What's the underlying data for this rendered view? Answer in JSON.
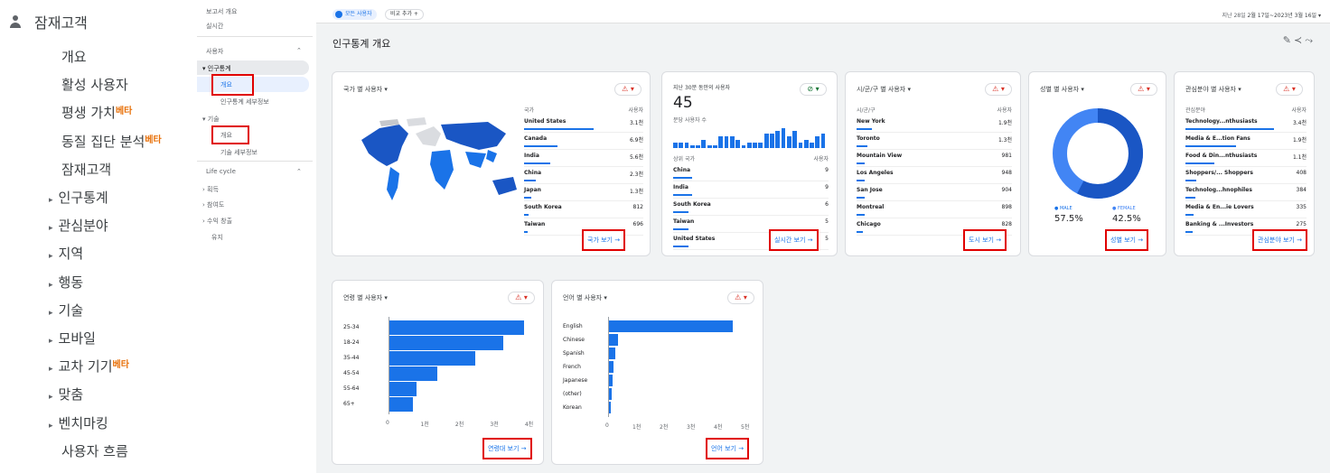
{
  "left_menu": {
    "header": "잠재고객",
    "items": [
      {
        "label": "개요",
        "caret": false,
        "beta": ""
      },
      {
        "label": "활성 사용자",
        "caret": false,
        "beta": ""
      },
      {
        "label": "평생 가치",
        "caret": false,
        "beta": "베타"
      },
      {
        "label": "동질 집단 분석",
        "caret": false,
        "beta": "베타"
      },
      {
        "label": "잠재고객",
        "caret": false,
        "beta": ""
      },
      {
        "label": "인구통계",
        "caret": true,
        "beta": ""
      },
      {
        "label": "관심분야",
        "caret": true,
        "beta": ""
      },
      {
        "label": "지역",
        "caret": true,
        "beta": ""
      },
      {
        "label": "행동",
        "caret": true,
        "beta": ""
      },
      {
        "label": "기술",
        "caret": true,
        "beta": ""
      },
      {
        "label": "모바일",
        "caret": true,
        "beta": ""
      },
      {
        "label": "교차 기기",
        "caret": true,
        "beta": "베타"
      },
      {
        "label": "맞춤",
        "caret": true,
        "beta": ""
      },
      {
        "label": "벤치마킹",
        "caret": true,
        "beta": ""
      },
      {
        "label": "사용자 흐름",
        "caret": false,
        "beta": ""
      }
    ]
  },
  "nav": {
    "report_overview": "보고서 개요",
    "realtime": "실시간",
    "user_section": "사용자",
    "demographics": "인구통계",
    "demo_overview": "개요",
    "demo_detail": "인구통계 세부정보",
    "tech": "기술",
    "tech_overview": "개요",
    "tech_detail": "기술 세부정보",
    "lifecycle": "Life cycle",
    "acquisition": "획득",
    "engagement": "참여도",
    "monetization": "수익 창출",
    "retention": "유지"
  },
  "top": {
    "all_users": "모든 사용자",
    "compare": "비교 추가 +",
    "date_prefix": "지난 28일",
    "date_range": "2월 17일~2023년 3월 16일",
    "page_title": "인구통계 개요"
  },
  "country": {
    "title": "국가 별 사용자 ▾",
    "col_k": "국가",
    "col_v": "사용자",
    "link": "국가 보기 →",
    "rows": [
      [
        "United States",
        "3.1천"
      ],
      [
        "Canada",
        "6.9천"
      ],
      [
        "India",
        "5.6천"
      ],
      [
        "China",
        "2.3천"
      ],
      [
        "Japan",
        "1.3천"
      ],
      [
        "South Korea",
        "812"
      ],
      [
        "Taiwan",
        "696"
      ]
    ]
  },
  "realtime": {
    "title": "지난 30분 동안의 사용자",
    "value": "45",
    "per_min": "분당 사용자 수",
    "col_k": "상위 국가",
    "col_v": "사용자",
    "link": "실시간 보기 →",
    "rows": [
      [
        "China",
        "9"
      ],
      [
        "India",
        "9"
      ],
      [
        "South Korea",
        "6"
      ],
      [
        "Taiwan",
        "5"
      ],
      [
        "United States",
        "5"
      ]
    ],
    "spark": [
      2,
      2,
      2,
      1,
      1,
      3,
      1,
      1,
      4,
      4,
      4,
      3,
      1,
      2,
      2,
      2,
      5,
      5,
      6,
      7,
      4,
      6,
      2,
      3,
      2,
      4,
      5
    ]
  },
  "city": {
    "title": "시/군/구 별 사용자 ▾",
    "col_k": "시/군/구",
    "col_v": "사용자",
    "link": "도시 보기 →",
    "rows": [
      [
        "New York",
        "1.9천"
      ],
      [
        "Toronto",
        "1.3천"
      ],
      [
        "Mountain View",
        "981"
      ],
      [
        "Los Angeles",
        "948"
      ],
      [
        "San Jose",
        "904"
      ],
      [
        "Montreal",
        "898"
      ],
      [
        "Chicago",
        "828"
      ]
    ]
  },
  "gender": {
    "title": "성별 별 사용자 ▾",
    "male_label": "● MALE",
    "female_label": "● FEMALE",
    "male": "57.5%",
    "female": "42.5%",
    "male_frac": 0.575,
    "link": "성별 보기 →"
  },
  "interest": {
    "title": "관심분야 별 사용자 ▾",
    "col_k": "관심분야",
    "col_v": "사용자",
    "link": "관심분야 보기 →",
    "rows": [
      [
        "Technology...nthusiasts",
        "3.4천"
      ],
      [
        "Media & E...tion Fans",
        "1.9천"
      ],
      [
        "Food & Din...nthusiasts",
        "1.1천"
      ],
      [
        "Shoppers/... Shoppers",
        "408"
      ],
      [
        "Technolog...hnophiles",
        "384"
      ],
      [
        "Media & En...ie Lovers",
        "335"
      ],
      [
        "Banking & ...Investors",
        "275"
      ]
    ]
  },
  "age": {
    "title": "연령 별 사용자 ▾",
    "link": "연령대 보기 →",
    "cats": [
      "25-34",
      "18-24",
      "35-44",
      "45-54",
      "55-64",
      "65+"
    ],
    "values": [
      3900,
      3300,
      2500,
      1400,
      800,
      700
    ],
    "ticks": [
      "0",
      "1천",
      "2천",
      "3천",
      "4천"
    ]
  },
  "lang": {
    "title": "언어 별 사용자 ▾",
    "link": "언어 보기 →",
    "cats": [
      "English",
      "Chinese",
      "Spanish",
      "French",
      "Japanese",
      "(other)",
      "Korean"
    ],
    "values": [
      4600,
      350,
      250,
      200,
      150,
      120,
      100
    ],
    "ticks": [
      "0",
      "1천",
      "2천",
      "3천",
      "4천",
      "5천"
    ]
  },
  "colors": {
    "accent": "#1a73e8",
    "warn": "#d93025",
    "highlight": "#e00000"
  }
}
